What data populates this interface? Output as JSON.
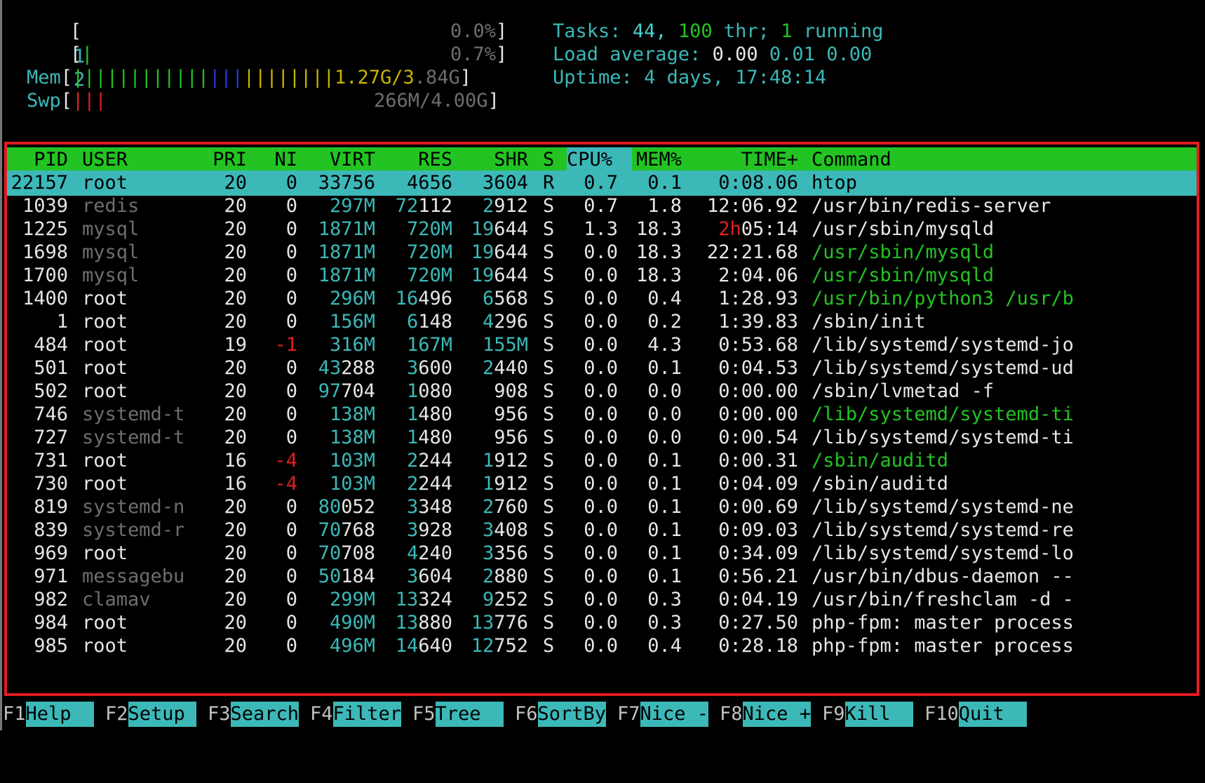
{
  "meters": {
    "cpu1": {
      "label": "1",
      "open": "[",
      "bars": "",
      "value": "0.0%",
      "close": "]"
    },
    "cpu2": {
      "label": "2",
      "open": "[",
      "bars": "|",
      "value": "0.7%",
      "close": "]"
    },
    "mem": {
      "label": "Mem",
      "open": "[",
      "green": "||||||||||||",
      "blue": "|||",
      "yellow": "||||||||",
      "used": "1.27G/3",
      "total": ".84G",
      "close": "]"
    },
    "swp": {
      "label": "Swp",
      "open": "[",
      "red": "|||",
      "value": "266M/4.00G",
      "close": "]"
    }
  },
  "summary": {
    "tasks_label": "Tasks:",
    "tasks": "44,",
    "thr": "100",
    "thr_label": "thr;",
    "running": "1",
    "running_label": "running",
    "load_label": "Load average:",
    "load1": "0.00",
    "load5": "0.01",
    "load15": "0.00",
    "uptime_label": "Uptime:",
    "uptime": "4 days, 17:48:14"
  },
  "columns": [
    "PID",
    "USER",
    "PRI",
    "NI",
    "VIRT",
    "RES",
    "SHR",
    "S",
    "CPU%",
    "MEM%",
    "TIME+",
    "Command"
  ],
  "processes": [
    {
      "pid": "22157",
      "user": "root",
      "pri": "20",
      "ni": "0",
      "virt": "33756",
      "res": "4656",
      "shr": "3604",
      "s": "R",
      "cpu": "0.7",
      "mem": "0.1",
      "time": "0:08.06",
      "cmd": "htop"
    },
    {
      "pid": "1039",
      "user": "redis",
      "pri": "20",
      "ni": "0",
      "virt": "297M",
      "res": "72112",
      "shr": "2912",
      "s": "S",
      "cpu": "0.7",
      "mem": "1.8",
      "time": "12:06.92",
      "cmd": "/usr/bin/redis-server"
    },
    {
      "pid": "1225",
      "user": "mysql",
      "pri": "20",
      "ni": "0",
      "virt": "1871M",
      "res": "720M",
      "shr": "19644",
      "s": "S",
      "cpu": "1.3",
      "mem": "18.3",
      "time": "2h05:14",
      "cmd": "/usr/sbin/mysqld"
    },
    {
      "pid": "1698",
      "user": "mysql",
      "pri": "20",
      "ni": "0",
      "virt": "1871M",
      "res": "720M",
      "shr": "19644",
      "s": "S",
      "cpu": "0.0",
      "mem": "18.3",
      "time": "22:21.68",
      "cmd": "/usr/sbin/mysqld"
    },
    {
      "pid": "1700",
      "user": "mysql",
      "pri": "20",
      "ni": "0",
      "virt": "1871M",
      "res": "720M",
      "shr": "19644",
      "s": "S",
      "cpu": "0.0",
      "mem": "18.3",
      "time": "2:04.06",
      "cmd": "/usr/sbin/mysqld"
    },
    {
      "pid": "1400",
      "user": "root",
      "pri": "20",
      "ni": "0",
      "virt": "296M",
      "res": "16496",
      "shr": "6568",
      "s": "S",
      "cpu": "0.0",
      "mem": "0.4",
      "time": "1:28.93",
      "cmd": "/usr/bin/python3 /usr/b"
    },
    {
      "pid": "1",
      "user": "root",
      "pri": "20",
      "ni": "0",
      "virt": "156M",
      "res": "6148",
      "shr": "4296",
      "s": "S",
      "cpu": "0.0",
      "mem": "0.2",
      "time": "1:39.83",
      "cmd": "/sbin/init"
    },
    {
      "pid": "484",
      "user": "root",
      "pri": "19",
      "ni": "-1",
      "virt": "316M",
      "res": "167M",
      "shr": "155M",
      "s": "S",
      "cpu": "0.0",
      "mem": "4.3",
      "time": "0:53.68",
      "cmd": "/lib/systemd/systemd-jo"
    },
    {
      "pid": "501",
      "user": "root",
      "pri": "20",
      "ni": "0",
      "virt": "43288",
      "res": "3600",
      "shr": "2440",
      "s": "S",
      "cpu": "0.0",
      "mem": "0.1",
      "time": "0:04.53",
      "cmd": "/lib/systemd/systemd-ud"
    },
    {
      "pid": "502",
      "user": "root",
      "pri": "20",
      "ni": "0",
      "virt": "97704",
      "res": "1080",
      "shr": "908",
      "s": "S",
      "cpu": "0.0",
      "mem": "0.0",
      "time": "0:00.00",
      "cmd": "/sbin/lvmetad -f"
    },
    {
      "pid": "746",
      "user": "systemd-t",
      "pri": "20",
      "ni": "0",
      "virt": "138M",
      "res": "1480",
      "shr": "956",
      "s": "S",
      "cpu": "0.0",
      "mem": "0.0",
      "time": "0:00.00",
      "cmd": "/lib/systemd/systemd-ti"
    },
    {
      "pid": "727",
      "user": "systemd-t",
      "pri": "20",
      "ni": "0",
      "virt": "138M",
      "res": "1480",
      "shr": "956",
      "s": "S",
      "cpu": "0.0",
      "mem": "0.0",
      "time": "0:00.54",
      "cmd": "/lib/systemd/systemd-ti"
    },
    {
      "pid": "731",
      "user": "root",
      "pri": "16",
      "ni": "-4",
      "virt": "103M",
      "res": "2244",
      "shr": "1912",
      "s": "S",
      "cpu": "0.0",
      "mem": "0.1",
      "time": "0:00.31",
      "cmd": "/sbin/auditd"
    },
    {
      "pid": "730",
      "user": "root",
      "pri": "16",
      "ni": "-4",
      "virt": "103M",
      "res": "2244",
      "shr": "1912",
      "s": "S",
      "cpu": "0.0",
      "mem": "0.1",
      "time": "0:04.09",
      "cmd": "/sbin/auditd"
    },
    {
      "pid": "819",
      "user": "systemd-n",
      "pri": "20",
      "ni": "0",
      "virt": "80052",
      "res": "3348",
      "shr": "2760",
      "s": "S",
      "cpu": "0.0",
      "mem": "0.1",
      "time": "0:00.69",
      "cmd": "/lib/systemd/systemd-ne"
    },
    {
      "pid": "839",
      "user": "systemd-r",
      "pri": "20",
      "ni": "0",
      "virt": "70768",
      "res": "3928",
      "shr": "3408",
      "s": "S",
      "cpu": "0.0",
      "mem": "0.1",
      "time": "0:09.03",
      "cmd": "/lib/systemd/systemd-re"
    },
    {
      "pid": "969",
      "user": "root",
      "pri": "20",
      "ni": "0",
      "virt": "70708",
      "res": "4240",
      "shr": "3356",
      "s": "S",
      "cpu": "0.0",
      "mem": "0.1",
      "time": "0:34.09",
      "cmd": "/lib/systemd/systemd-lo"
    },
    {
      "pid": "971",
      "user": "messagebu",
      "pri": "20",
      "ni": "0",
      "virt": "50184",
      "res": "3604",
      "shr": "2880",
      "s": "S",
      "cpu": "0.0",
      "mem": "0.1",
      "time": "0:56.21",
      "cmd": "/usr/bin/dbus-daemon --"
    },
    {
      "pid": "982",
      "user": "clamav",
      "pri": "20",
      "ni": "0",
      "virt": "299M",
      "res": "13324",
      "shr": "9252",
      "s": "S",
      "cpu": "0.0",
      "mem": "0.3",
      "time": "0:04.19",
      "cmd": "/usr/bin/freshclam -d -"
    },
    {
      "pid": "984",
      "user": "root",
      "pri": "20",
      "ni": "0",
      "virt": "490M",
      "res": "13880",
      "shr": "13776",
      "s": "S",
      "cpu": "0.0",
      "mem": "0.3",
      "time": "0:27.50",
      "cmd": "php-fpm: master process"
    },
    {
      "pid": "985",
      "user": "root",
      "pri": "20",
      "ni": "0",
      "virt": "496M",
      "res": "14640",
      "shr": "12752",
      "s": "S",
      "cpu": "0.0",
      "mem": "0.4",
      "time": "0:28.18",
      "cmd": "php-fpm: master process"
    }
  ],
  "function_keys": [
    {
      "key": "F1",
      "label": "Help  "
    },
    {
      "key": "F2",
      "label": "Setup "
    },
    {
      "key": "F3",
      "label": "Search"
    },
    {
      "key": "F4",
      "label": "Filter"
    },
    {
      "key": "F5",
      "label": "Tree  "
    },
    {
      "key": "F6",
      "label": "SortBy"
    },
    {
      "key": "F7",
      "label": "Nice -"
    },
    {
      "key": "F8",
      "label": "Nice +"
    },
    {
      "key": "F9",
      "label": "Kill  "
    },
    {
      "key": "F10",
      "label": "Quit  "
    }
  ],
  "colors": {
    "cyan": "#3cb8b8",
    "green": "#22c322",
    "red": "#e21b23",
    "yellow": "#c9b400",
    "blue": "#2a3ad0"
  }
}
